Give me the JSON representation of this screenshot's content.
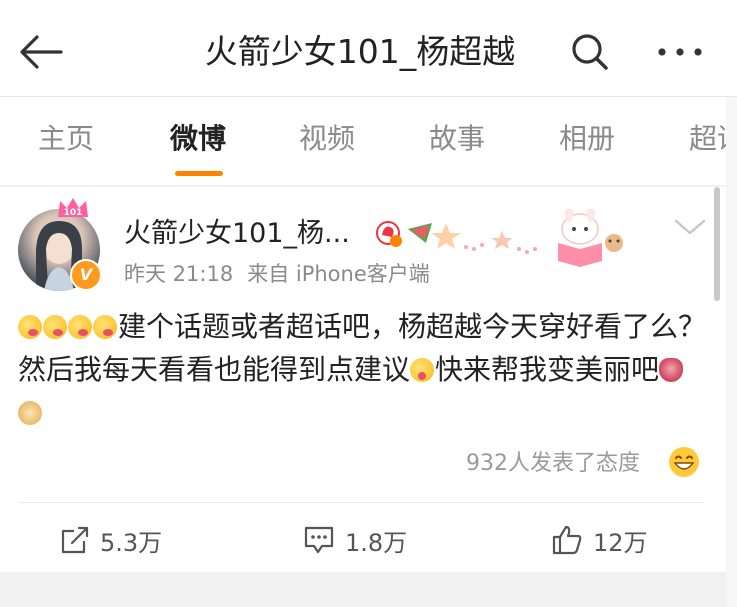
{
  "header": {
    "title": "火箭少女101_杨超越"
  },
  "tabs": [
    {
      "label": "主页"
    },
    {
      "label": "微博"
    },
    {
      "label": "视频"
    },
    {
      "label": "故事"
    },
    {
      "label": "相册"
    },
    {
      "label": "超话"
    }
  ],
  "post": {
    "username": "火箭少女101_杨...",
    "time": "昨天 21:18",
    "source": "来自 iPhone客户端",
    "text_part1": "建个话题或者超话吧，杨超越今天穿好看了么？然后我每天看看也能得到点建议",
    "text_part2": "快来帮我变美丽吧",
    "reactions": "932人发表了态度",
    "repost_count": "5.3万",
    "comment_count": "1.8万",
    "like_count": "12万",
    "avatar_crown_text": "101",
    "vip_badge": "V"
  },
  "colors": {
    "accent": "#ff8200",
    "verified": "#ff9a1f"
  }
}
